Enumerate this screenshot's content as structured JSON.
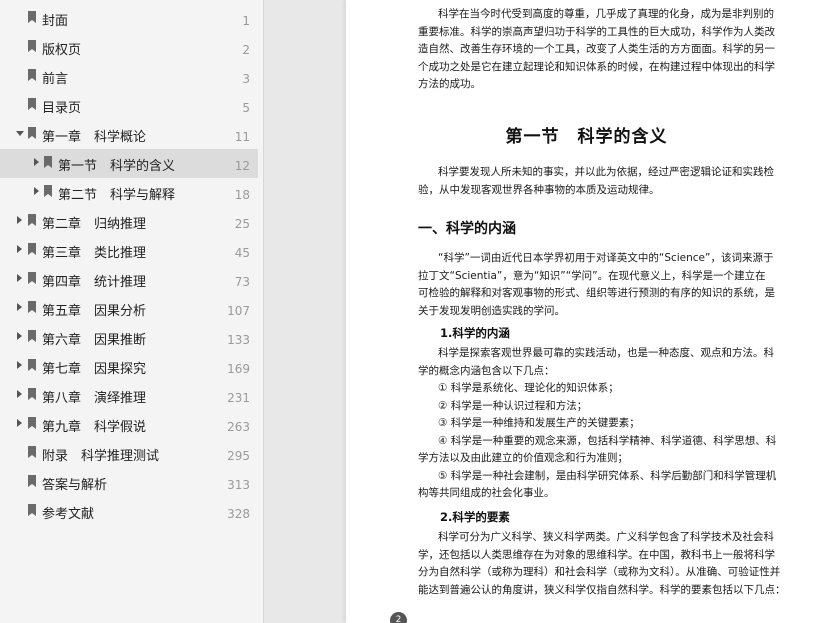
{
  "bookmarks": [
    {
      "label": "封面",
      "page": "1"
    },
    {
      "label": "版权页",
      "page": "2"
    },
    {
      "label": "前言",
      "page": "3"
    },
    {
      "label": "目录页",
      "page": "5"
    },
    {
      "label": "第一章　科学概论",
      "page": "11"
    },
    {
      "label": "第一节　科学的含义",
      "page": "12"
    },
    {
      "label": "第二节　科学与解释",
      "page": "18"
    },
    {
      "label": "第二章　归纳推理",
      "page": "25"
    },
    {
      "label": "第三章　类比推理",
      "page": "45"
    },
    {
      "label": "第四章　统计推理",
      "page": "73"
    },
    {
      "label": "第五章　因果分析",
      "page": "107"
    },
    {
      "label": "第六章　因果推断",
      "page": "133"
    },
    {
      "label": "第七章　因果探究",
      "page": "169"
    },
    {
      "label": "第八章　演绎推理",
      "page": "231"
    },
    {
      "label": "第九章　科学假说",
      "page": "263"
    },
    {
      "label": "附录　科学推理测试",
      "page": "295"
    },
    {
      "label": "答案与解析",
      "page": "313"
    },
    {
      "label": "参考文献",
      "page": "328"
    }
  ],
  "doc": {
    "intro_lines": [
      "科学在当今时代受到高度的尊重，几乎成了真理的化身，成为是非判别的",
      "重要标准。科学的崇高声望归功于科学的工具性的巨大成功，科学作为人类改",
      "造自然、改善生存环境的一个工具，改变了人类生活的方方面面。科学的另一",
      "个成功之处是它在建立起理论和知识体系的时候，在构建过程中体现出的科学",
      "方法的成功。"
    ],
    "section_title": "第一节　科学的含义",
    "section_intro_lines": [
      "科学要发现人所未知的事实，并以此为依据，经过严密逻辑论证和实践检",
      "验，从中发现客观世界各种事物的本质及运动规律。"
    ],
    "h2_title": "一、科学的内涵",
    "para1_lines": [
      "“科学”一词由近代日本学界初用于对译英文中的“Science”，该词来源于",
      "拉丁文“Scientia”，意为“知识”“学问”。在现代意义上，科学是一个建立在",
      "可检验的解释和对客观事物的形式、组织等进行预测的有序的知识的系统，是",
      "关于发现发明创造实践的学问。"
    ],
    "h3_1": "1.科学的内涵",
    "para2_lines": [
      "科学是探索客观世界最可靠的实践活动，也是一种态度、观点和方法。科",
      "学的概念内涵包含以下几点："
    ],
    "list_items": [
      "① 科学是系统化、理论化的知识体系；",
      "② 科学是一种认识过程和方法；",
      "③ 科学是一种维持和发展生产的关键要素；",
      "④ 科学是一种重要的观念来源，包括科学精神、科学道德、科学思想、科",
      "学方法以及由此建立的价值观念和行为准则；",
      "⑤ 科学是一种社会建制，是由科学研究体系、科学后勤部门和科学管理机",
      "构等共同组成的社会化事业。"
    ],
    "h3_2": "2.科学的要素",
    "para3_lines": [
      "科学可分为广义科学、狭义科学两类。广义科学包含了科学技术及社会科",
      "学，还包括以人类思维存在为对象的思维科学。在中国，教科书上一般将科学",
      "分为自然科学（或称为理科）和社会科学（或称为文科）。从准确、可验证性并",
      "能达到普遍公认的角度讲，狭义科学仅指自然科学。科学的要素包括以下几点："
    ],
    "page_badge": "2"
  },
  "colors": {
    "sidebar_bg": "#f4f4f4",
    "selected_bg": "#dcdcdc",
    "page_number": "#9a9a9a"
  }
}
